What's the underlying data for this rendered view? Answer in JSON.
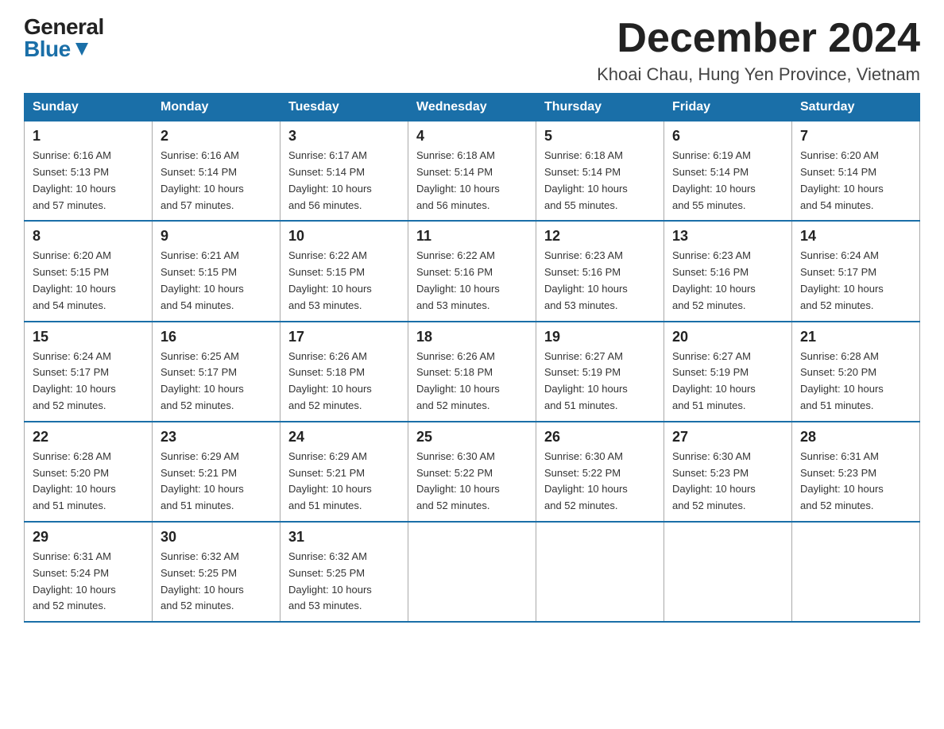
{
  "logo": {
    "general": "General",
    "blue": "Blue"
  },
  "title": "December 2024",
  "location": "Khoai Chau, Hung Yen Province, Vietnam",
  "days_of_week": [
    "Sunday",
    "Monday",
    "Tuesday",
    "Wednesday",
    "Thursday",
    "Friday",
    "Saturday"
  ],
  "weeks": [
    [
      {
        "day": "1",
        "sunrise": "6:16 AM",
        "sunset": "5:13 PM",
        "daylight": "10 hours and 57 minutes."
      },
      {
        "day": "2",
        "sunrise": "6:16 AM",
        "sunset": "5:14 PM",
        "daylight": "10 hours and 57 minutes."
      },
      {
        "day": "3",
        "sunrise": "6:17 AM",
        "sunset": "5:14 PM",
        "daylight": "10 hours and 56 minutes."
      },
      {
        "day": "4",
        "sunrise": "6:18 AM",
        "sunset": "5:14 PM",
        "daylight": "10 hours and 56 minutes."
      },
      {
        "day": "5",
        "sunrise": "6:18 AM",
        "sunset": "5:14 PM",
        "daylight": "10 hours and 55 minutes."
      },
      {
        "day": "6",
        "sunrise": "6:19 AM",
        "sunset": "5:14 PM",
        "daylight": "10 hours and 55 minutes."
      },
      {
        "day": "7",
        "sunrise": "6:20 AM",
        "sunset": "5:14 PM",
        "daylight": "10 hours and 54 minutes."
      }
    ],
    [
      {
        "day": "8",
        "sunrise": "6:20 AM",
        "sunset": "5:15 PM",
        "daylight": "10 hours and 54 minutes."
      },
      {
        "day": "9",
        "sunrise": "6:21 AM",
        "sunset": "5:15 PM",
        "daylight": "10 hours and 54 minutes."
      },
      {
        "day": "10",
        "sunrise": "6:22 AM",
        "sunset": "5:15 PM",
        "daylight": "10 hours and 53 minutes."
      },
      {
        "day": "11",
        "sunrise": "6:22 AM",
        "sunset": "5:16 PM",
        "daylight": "10 hours and 53 minutes."
      },
      {
        "day": "12",
        "sunrise": "6:23 AM",
        "sunset": "5:16 PM",
        "daylight": "10 hours and 53 minutes."
      },
      {
        "day": "13",
        "sunrise": "6:23 AM",
        "sunset": "5:16 PM",
        "daylight": "10 hours and 52 minutes."
      },
      {
        "day": "14",
        "sunrise": "6:24 AM",
        "sunset": "5:17 PM",
        "daylight": "10 hours and 52 minutes."
      }
    ],
    [
      {
        "day": "15",
        "sunrise": "6:24 AM",
        "sunset": "5:17 PM",
        "daylight": "10 hours and 52 minutes."
      },
      {
        "day": "16",
        "sunrise": "6:25 AM",
        "sunset": "5:17 PM",
        "daylight": "10 hours and 52 minutes."
      },
      {
        "day": "17",
        "sunrise": "6:26 AM",
        "sunset": "5:18 PM",
        "daylight": "10 hours and 52 minutes."
      },
      {
        "day": "18",
        "sunrise": "6:26 AM",
        "sunset": "5:18 PM",
        "daylight": "10 hours and 52 minutes."
      },
      {
        "day": "19",
        "sunrise": "6:27 AM",
        "sunset": "5:19 PM",
        "daylight": "10 hours and 51 minutes."
      },
      {
        "day": "20",
        "sunrise": "6:27 AM",
        "sunset": "5:19 PM",
        "daylight": "10 hours and 51 minutes."
      },
      {
        "day": "21",
        "sunrise": "6:28 AM",
        "sunset": "5:20 PM",
        "daylight": "10 hours and 51 minutes."
      }
    ],
    [
      {
        "day": "22",
        "sunrise": "6:28 AM",
        "sunset": "5:20 PM",
        "daylight": "10 hours and 51 minutes."
      },
      {
        "day": "23",
        "sunrise": "6:29 AM",
        "sunset": "5:21 PM",
        "daylight": "10 hours and 51 minutes."
      },
      {
        "day": "24",
        "sunrise": "6:29 AM",
        "sunset": "5:21 PM",
        "daylight": "10 hours and 51 minutes."
      },
      {
        "day": "25",
        "sunrise": "6:30 AM",
        "sunset": "5:22 PM",
        "daylight": "10 hours and 52 minutes."
      },
      {
        "day": "26",
        "sunrise": "6:30 AM",
        "sunset": "5:22 PM",
        "daylight": "10 hours and 52 minutes."
      },
      {
        "day": "27",
        "sunrise": "6:30 AM",
        "sunset": "5:23 PM",
        "daylight": "10 hours and 52 minutes."
      },
      {
        "day": "28",
        "sunrise": "6:31 AM",
        "sunset": "5:23 PM",
        "daylight": "10 hours and 52 minutes."
      }
    ],
    [
      {
        "day": "29",
        "sunrise": "6:31 AM",
        "sunset": "5:24 PM",
        "daylight": "10 hours and 52 minutes."
      },
      {
        "day": "30",
        "sunrise": "6:32 AM",
        "sunset": "5:25 PM",
        "daylight": "10 hours and 52 minutes."
      },
      {
        "day": "31",
        "sunrise": "6:32 AM",
        "sunset": "5:25 PM",
        "daylight": "10 hours and 53 minutes."
      },
      null,
      null,
      null,
      null
    ]
  ],
  "labels": {
    "sunrise": "Sunrise:",
    "sunset": "Sunset:",
    "daylight": "Daylight:"
  }
}
